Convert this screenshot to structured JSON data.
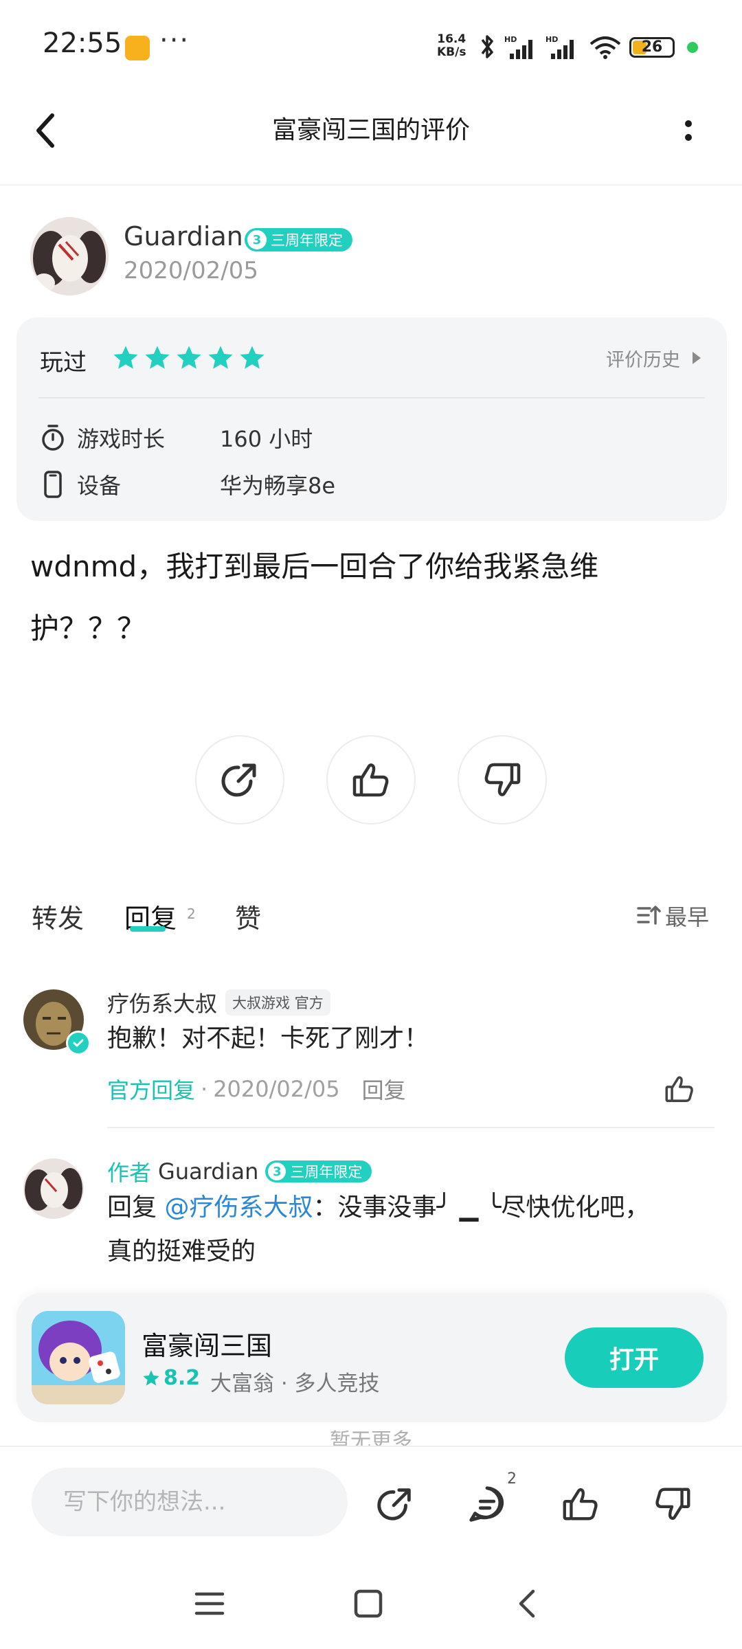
{
  "status_bar": {
    "time": "22:55",
    "notification_icon": "message-app-icon",
    "more": "···",
    "speed_value": "16.4",
    "speed_unit": "KB/s",
    "battery": "26",
    "colors": {
      "battery_fill": "#f2b01e",
      "dot": "#2ecc5b"
    }
  },
  "header": {
    "title": "富豪闯三国的评价",
    "back_icon": "back-arrow-icon",
    "more_icon": "more-vertical-icon"
  },
  "reviewer": {
    "name": "Guardian",
    "badge_number": "3",
    "badge": "三周年限定",
    "date": "2020/02/05"
  },
  "info_card": {
    "status": "玩过",
    "stars": 5,
    "history": "评价历史",
    "playtime_label": "游戏时长",
    "playtime_value": "160 小时",
    "device_label": "设备",
    "device_value": "华为畅享8e"
  },
  "review": {
    "line1": "wdnmd，我打到最后一回合了你给我紧急维",
    "line2": "护？？？"
  },
  "actions": [
    "share-icon",
    "thumbs-up-icon",
    "thumbs-down-icon"
  ],
  "tabs": {
    "forward": "转发",
    "reply": "回复",
    "reply_count": "2",
    "like": "赞",
    "sort": "最早"
  },
  "comments": [
    {
      "name": "疗伤系大叔",
      "tag": "大叔游戏 官方",
      "text": "抱歉！对不起！卡死了刚才！",
      "official": "官方回复",
      "date": "2020/02/05",
      "reply": "回复"
    },
    {
      "author_label": "作者",
      "name": "Guardian",
      "badge_number": "3",
      "badge": "三周年限定",
      "reply_prefix": "回复 ",
      "mention": "@疗伤系大叔",
      "text_rest": "：没事没事╯ ▁ ╰尽快优化吧，",
      "text_line2": "真的挺难受的"
    }
  ],
  "app_banner": {
    "name": "富豪闯三国",
    "rating": "8.2",
    "tags": "大富翁 · 多人竞技",
    "open": "打开"
  },
  "no_more": "暂无更多",
  "bottom_bar": {
    "placeholder": "写下你的想法...",
    "comment_count": "2"
  },
  "nav": [
    "menu-icon",
    "home-square-icon",
    "nav-back-icon"
  ],
  "colors": {
    "accent": "#22d0bf",
    "mention": "#2a87d8",
    "open_button": "#19cdbb"
  }
}
